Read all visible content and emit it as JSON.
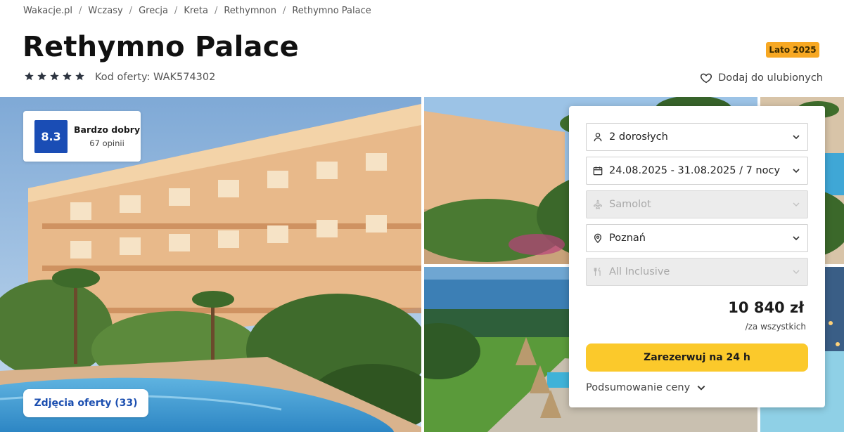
{
  "breadcrumb": [
    "Wakacje.pl",
    "Wczasy",
    "Grecja",
    "Kreta",
    "Rethymnon",
    "Rethymno Palace"
  ],
  "breadcrumb_separator": "/",
  "hotel": {
    "name": "Rethymno Palace",
    "stars": 5,
    "offer_code": "Kod oferty: WAK574302",
    "season_badge": "Lato 2025",
    "favorite_label": "Dodaj do ulubionych"
  },
  "rating": {
    "score": "8.3",
    "label": "Bardzo dobry",
    "count": "67 opinii"
  },
  "gallery": {
    "photos_button": "Zdjęcia oferty (33)"
  },
  "booking": {
    "guests": "2 dorosłych",
    "dates": "24.08.2025 - 31.08.2025 / 7 nocy",
    "transport": "Samolot",
    "departure": "Poznań",
    "board": "All Inclusive",
    "price": "10 840 zł",
    "price_note": "/za wszystkich",
    "reserve_button": "Zarezerwuj na 24 h",
    "summary_link": "Podsumowanie ceny"
  },
  "icons": {
    "guests": "person-icon",
    "dates": "calendar-icon",
    "transport": "airplane-icon",
    "departure": "location-pin-icon",
    "board": "utensils-icon",
    "favorite": "heart-icon",
    "star": "star-icon"
  },
  "colors": {
    "accent_blue": "#1a4db5",
    "reserve_yellow": "#fbc92b",
    "badge_orange": "#f7a823"
  }
}
